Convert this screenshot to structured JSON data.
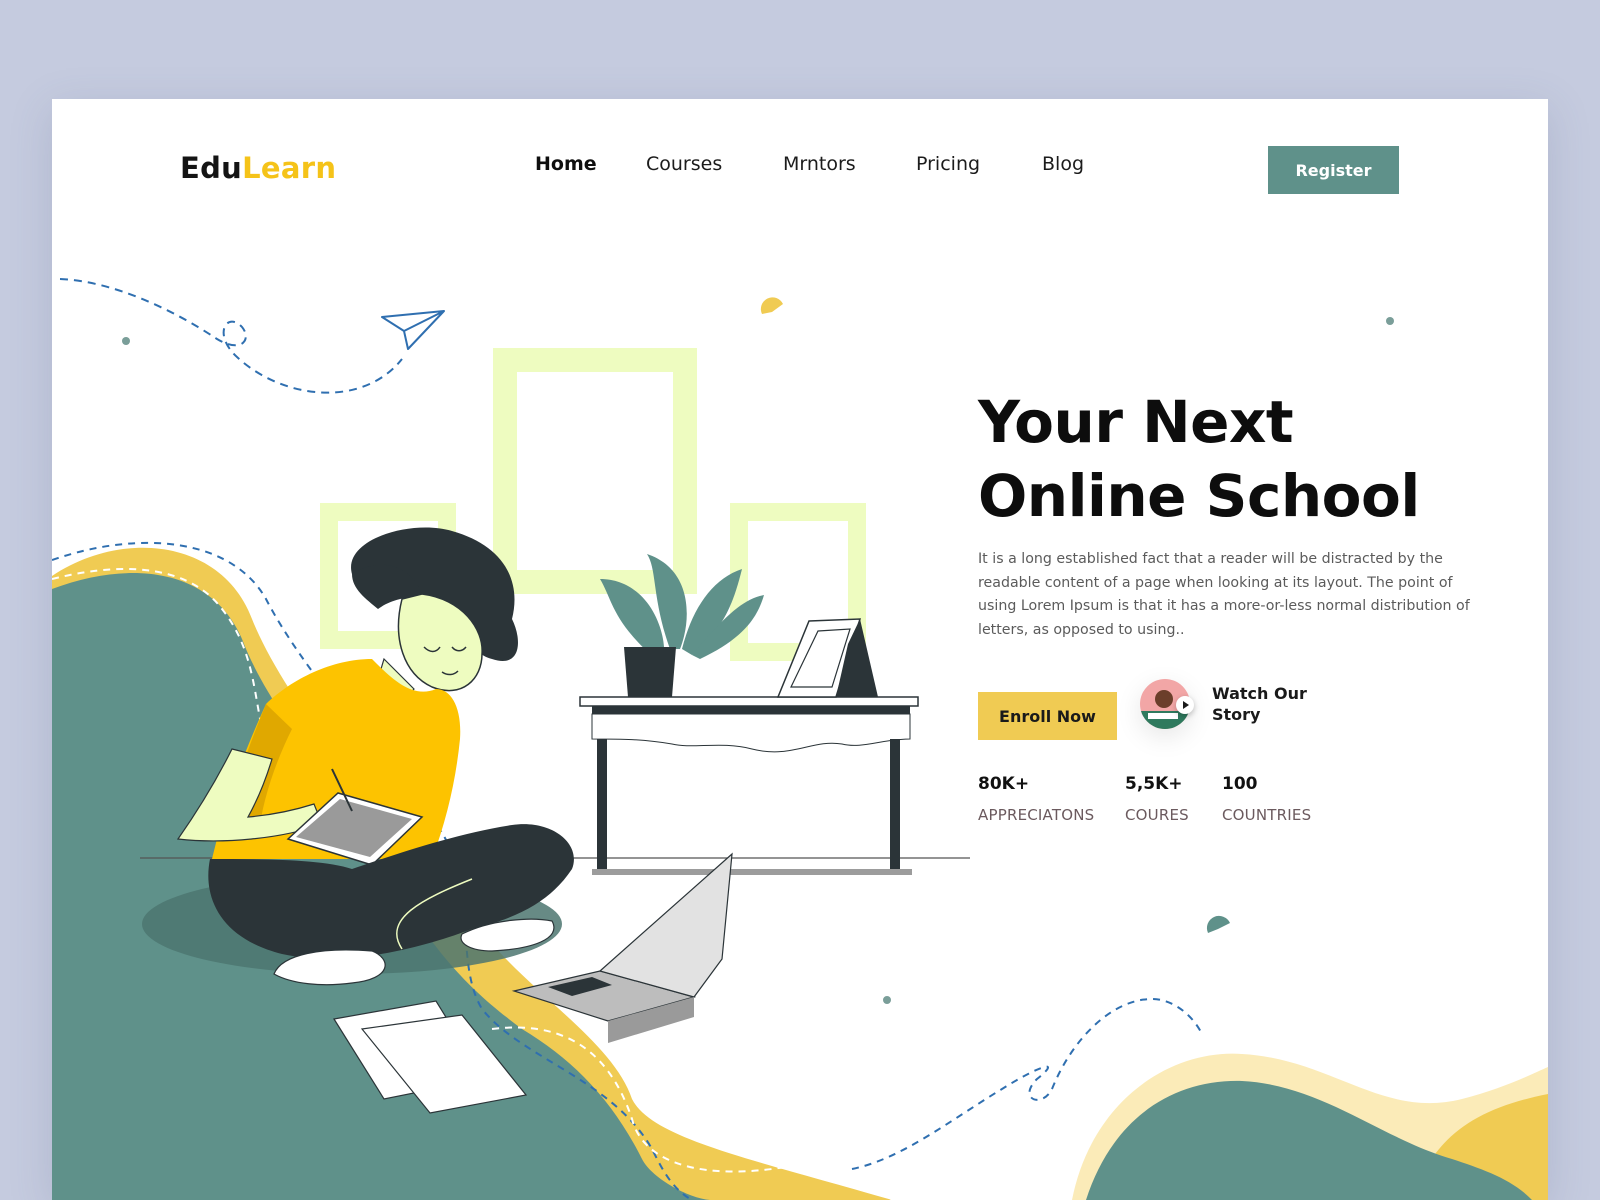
{
  "brand": {
    "part1": "Edu",
    "part2": "Learn"
  },
  "nav": {
    "items": [
      {
        "label": "Home",
        "active": true
      },
      {
        "label": "Courses"
      },
      {
        "label": "Mrntors"
      },
      {
        "label": "Pricing"
      },
      {
        "label": "Blog"
      }
    ],
    "register_label": "Register"
  },
  "hero": {
    "title_line1": "Your Next",
    "title_line2": "Online School",
    "description": "It is a long established fact that a reader will be distracted by the readable content of a page when looking at its layout. The point of using Lorem Ipsum is that it has a more-or-less normal distribution of letters, as opposed to using..",
    "enroll_label": "Enroll Now",
    "watch_label": "Watch Our Story"
  },
  "stats": [
    {
      "value": "80K+",
      "label": "APPRECIATONS"
    },
    {
      "value": "5,5K+",
      "label": "COURES"
    },
    {
      "value": "100",
      "label": "COUNTRIES"
    }
  ],
  "colors": {
    "brand_yellow": "#f5c319",
    "teal": "#5f918a",
    "button_yellow": "#f0cb53",
    "frame_green": "#eefcc0",
    "background": "#c5cbdf"
  }
}
